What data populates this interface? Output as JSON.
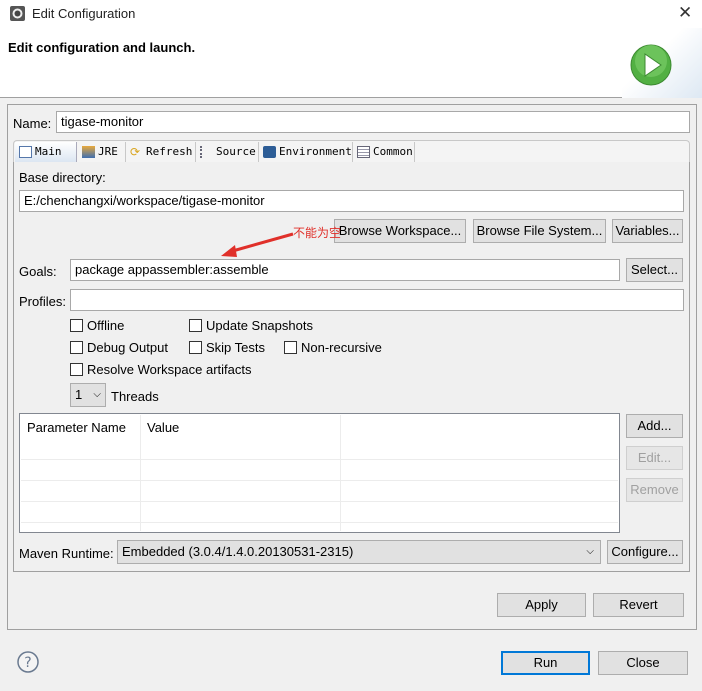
{
  "window": {
    "title": "Edit Configuration",
    "close_label": "✕"
  },
  "header": {
    "title": "Edit configuration and launch.",
    "icon": "run-play-icon"
  },
  "name": {
    "label": "Name:",
    "value": "tigase-monitor"
  },
  "tabs": [
    {
      "label": "Main",
      "icon": "main-tab-icon",
      "selected": true
    },
    {
      "label": "JRE",
      "icon": "jre-icon"
    },
    {
      "label": "Refresh",
      "icon": "refresh-icon"
    },
    {
      "label": "Source",
      "icon": "source-icon"
    },
    {
      "label": "Environment",
      "icon": "environment-icon"
    },
    {
      "label": "Common",
      "icon": "common-icon"
    }
  ],
  "main": {
    "base_dir_label": "Base directory:",
    "base_dir_value": "E:/chenchangxi/workspace/tigase-monitor",
    "browse_workspace": "Browse Workspace...",
    "browse_fs": "Browse File System...",
    "variables": "Variables...",
    "annotation": "不能为空",
    "goals_label": "Goals:",
    "goals_value": "package appassembler:assemble",
    "select": "Select...",
    "profiles_label": "Profiles:",
    "profiles_value": "",
    "checkboxes": {
      "offline": "Offline",
      "update_snapshots": "Update Snapshots",
      "debug_output": "Debug Output",
      "skip_tests": "Skip Tests",
      "non_recursive": "Non-recursive",
      "resolve_workspace": "Resolve Workspace artifacts"
    },
    "threads_value": "1",
    "threads_label": "Threads",
    "table": {
      "columns": [
        "Parameter Name",
        "Value"
      ],
      "rows": []
    },
    "add": "Add...",
    "edit": "Edit...",
    "remove": "Remove",
    "runtime_label": "Maven Runtime:",
    "runtime_value": "Embedded (3.0.4/1.4.0.20130531-2315)",
    "configure": "Configure..."
  },
  "apply": "Apply",
  "revert": "Revert",
  "run": "Run",
  "close": "Close",
  "colors": {
    "accent": "#0078d7",
    "annotation": "#e0302a"
  }
}
